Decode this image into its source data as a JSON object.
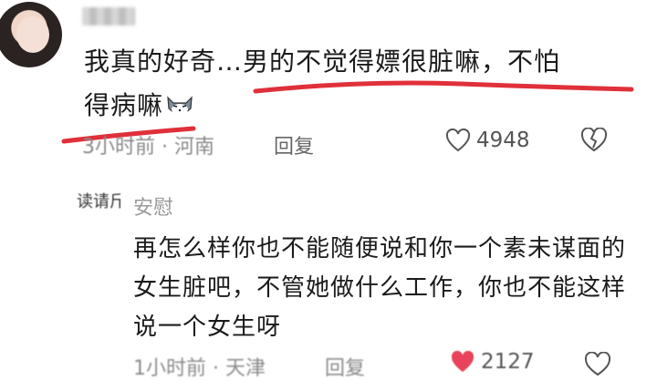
{
  "comment": {
    "text_line1": "我真的好奇…男的不觉得嫖很脏嘛，不怕",
    "text_line2": "得病嘛",
    "time": "3小时前",
    "location": "河南",
    "reply_label": "回复",
    "likes": "4948"
  },
  "reply": {
    "author_avatar_text": "读请斤",
    "author_name": "安慰",
    "text": "再怎么样你也不能随便说和你一个素未谋面的女生脏吧，不管她做什么工作，你也不能这样说一个女生呀",
    "time": "1小时前",
    "location": "天津",
    "reply_label": "回复",
    "likes": "2127"
  },
  "colors": {
    "underline": "#e0303a",
    "meta": "#8a8a8a",
    "heart_liked": "#e8435a"
  }
}
